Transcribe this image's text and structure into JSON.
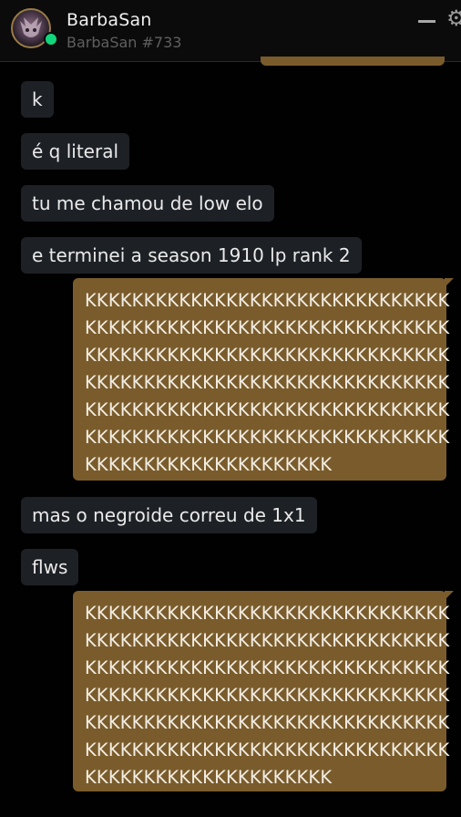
{
  "header": {
    "name": "BarbaSan",
    "tag": "BarbaSan #733",
    "minimize_icon": "minimize-icon",
    "settings_icon": "gear-icon",
    "status_color": "#12d67b"
  },
  "colors": {
    "incoming_bubble": "#1d2126",
    "outgoing_bubble": "#7a5c2c",
    "background": "#010101"
  },
  "messages": [
    {
      "direction": "in",
      "text": "k"
    },
    {
      "direction": "in",
      "text": "é q literal"
    },
    {
      "direction": "in",
      "text": "tu me chamou de low elo"
    },
    {
      "direction": "in",
      "text": "e terminei a season 1910 lp rank 2"
    },
    {
      "direction": "out",
      "lines": [
        "KKKKKKKKKKKKKKKKKKKKKKKKKKKKKKK",
        "KKKKKKKKKKKKKKKKKKKKKKKKKKKKKKK",
        "KKKKKKKKKKKKKKKKKKKKKKKKKKKKKKK",
        "KKKKKKKKKKKKKKKKKKKKKKKKKKKKKKK",
        "KKKKKKKKKKKKKKKKKKKKKKKKKKKKKKK",
        "KKKKKKKKKKKKKKKKKKKKKKKKKKKKKKK",
        "KKKKKKKKKKKKKKKKKKKKK"
      ]
    },
    {
      "direction": "in",
      "text": "mas o negroide correu de 1x1"
    },
    {
      "direction": "in",
      "text": "flws"
    },
    {
      "direction": "out",
      "lines": [
        "KKKKKKKKKKKKKKKKKKKKKKKKKKKKKKK",
        "KKKKKKKKKKKKKKKKKKKKKKKKKKKKKKK",
        "KKKKKKKKKKKKKKKKKKKKKKKKKKKKKKK",
        "KKKKKKKKKKKKKKKKKKKKKKKKKKKKKKK",
        "KKKKKKKKKKKKKKKKKKKKKKKKKKKKKKK",
        "KKKKKKKKKKKKKKKKKKKKKKKKKKKKKKK",
        "KKKKKKKKKKKKKKKKKKKKK"
      ]
    }
  ]
}
